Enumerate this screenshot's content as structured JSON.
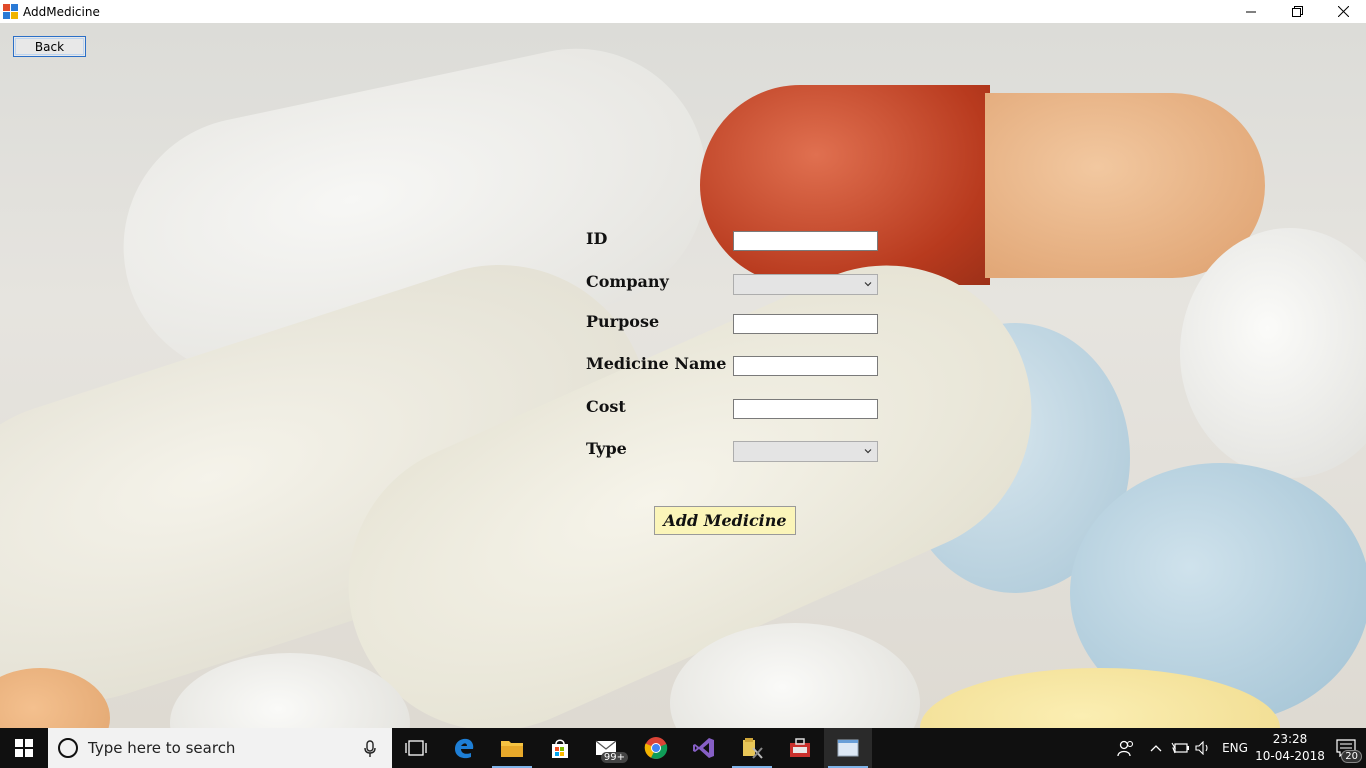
{
  "window": {
    "title": "AddMedicine",
    "minimize_glyph": "—",
    "maximize_glyph": "❐",
    "close_glyph": "✕"
  },
  "toolbar": {
    "back_label": "Back"
  },
  "form": {
    "id_label": "ID",
    "id_value": "",
    "company_label": "Company",
    "company_value": "",
    "purpose_label": "Purpose",
    "purpose_value": "",
    "medicine_name_label": "Medicine Name",
    "medicine_name_value": "",
    "cost_label": "Cost",
    "cost_value": "",
    "type_label": "Type",
    "type_value": "",
    "submit_label": "Add Medicine"
  },
  "taskbar": {
    "search_placeholder": "Type here to search",
    "mail_badge": "99+",
    "language": "ENG",
    "time": "23:28",
    "date": "10-04-2018",
    "notification_count": "20"
  },
  "colors": {
    "accent": "#2b6fc7",
    "add_button_bg": "#fbf5b9",
    "taskbar_bg": "#101010"
  }
}
